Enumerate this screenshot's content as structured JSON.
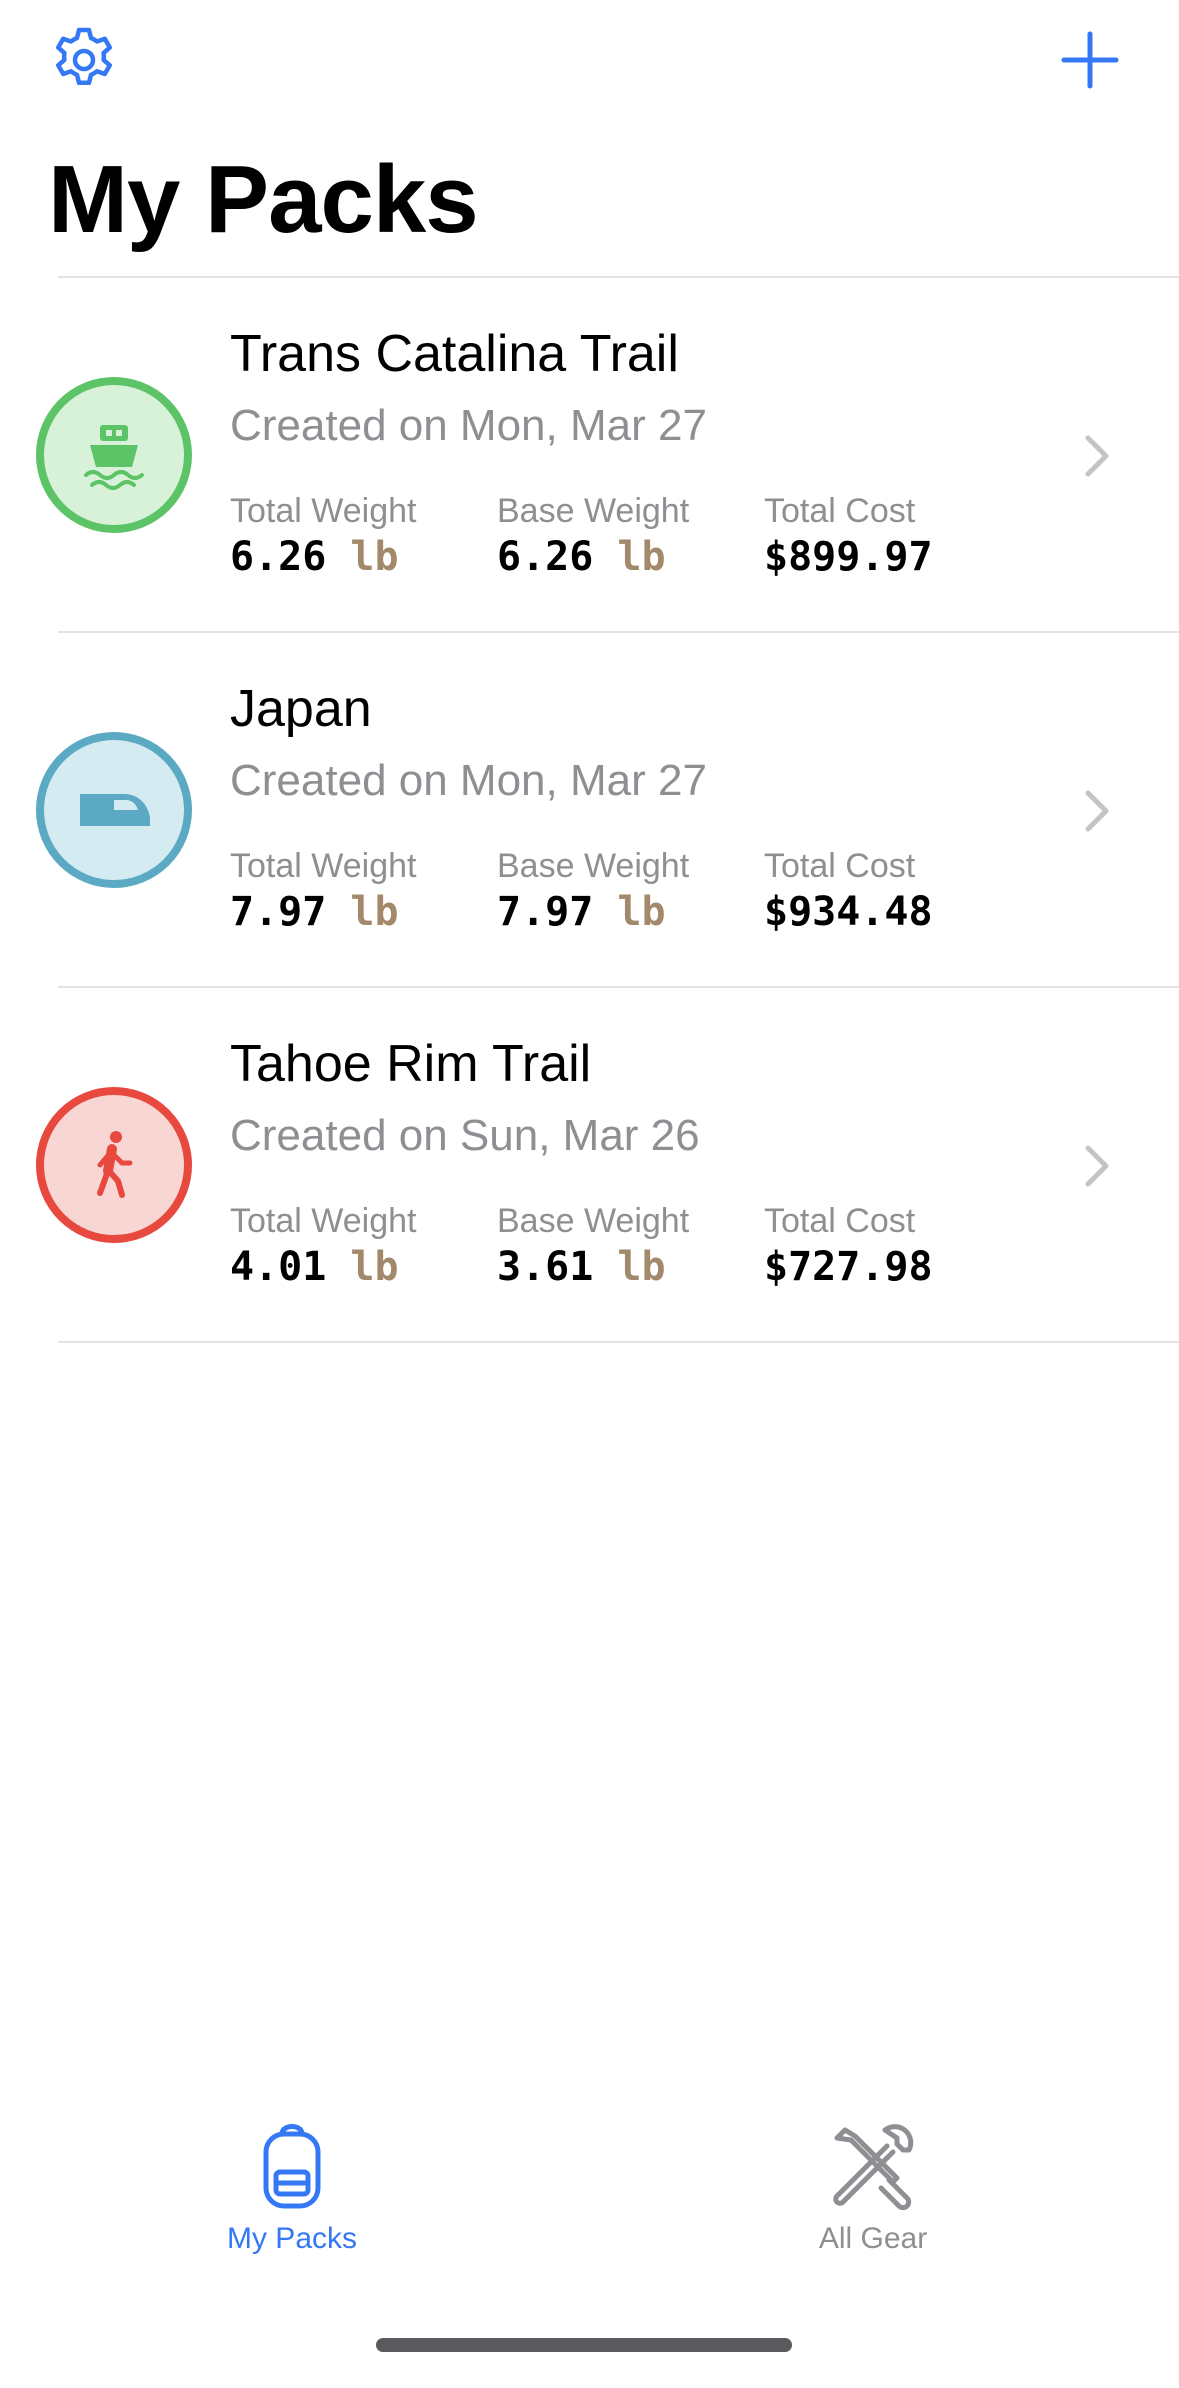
{
  "nav": {
    "settings_icon": "gear-icon",
    "add_icon": "plus-icon",
    "title": "My Packs"
  },
  "colors": {
    "accent": "#3478f6",
    "muted": "#8e8e93",
    "unit": "#a2896b",
    "green": "#5cc466",
    "green_bg": "#d8f2da",
    "teal": "#5ba9c2",
    "teal_bg": "#d3ebf1",
    "red": "#e8493f",
    "red_bg": "#f8d6d4"
  },
  "packs": [
    {
      "name": "Trans Catalina Trail",
      "created": "Created on Mon, Mar 27",
      "icon": "ferry-icon",
      "total_weight_label": "Total Weight",
      "total_weight_value": "6.26",
      "total_weight_unit": "lb",
      "base_weight_label": "Base Weight",
      "base_weight_value": "6.26",
      "base_weight_unit": "lb",
      "total_cost_label": "Total Cost",
      "total_cost_value": "$899.97"
    },
    {
      "name": "Japan",
      "created": "Created on Mon, Mar 27",
      "icon": "train-icon",
      "total_weight_label": "Total Weight",
      "total_weight_value": "7.97",
      "total_weight_unit": "lb",
      "base_weight_label": "Base Weight",
      "base_weight_value": "7.97",
      "base_weight_unit": "lb",
      "total_cost_label": "Total Cost",
      "total_cost_value": "$934.48"
    },
    {
      "name": "Tahoe Rim Trail",
      "created": "Created on Sun, Mar 26",
      "icon": "hiker-icon",
      "total_weight_label": "Total Weight",
      "total_weight_value": "4.01",
      "total_weight_unit": "lb",
      "base_weight_label": "Base Weight",
      "base_weight_value": "3.61",
      "base_weight_unit": "lb",
      "total_cost_label": "Total Cost",
      "total_cost_value": "$727.98"
    }
  ],
  "tabs": [
    {
      "label": "My Packs",
      "icon": "backpack-icon",
      "selected": true
    },
    {
      "label": "All Gear",
      "icon": "tools-icon",
      "selected": false
    }
  ]
}
